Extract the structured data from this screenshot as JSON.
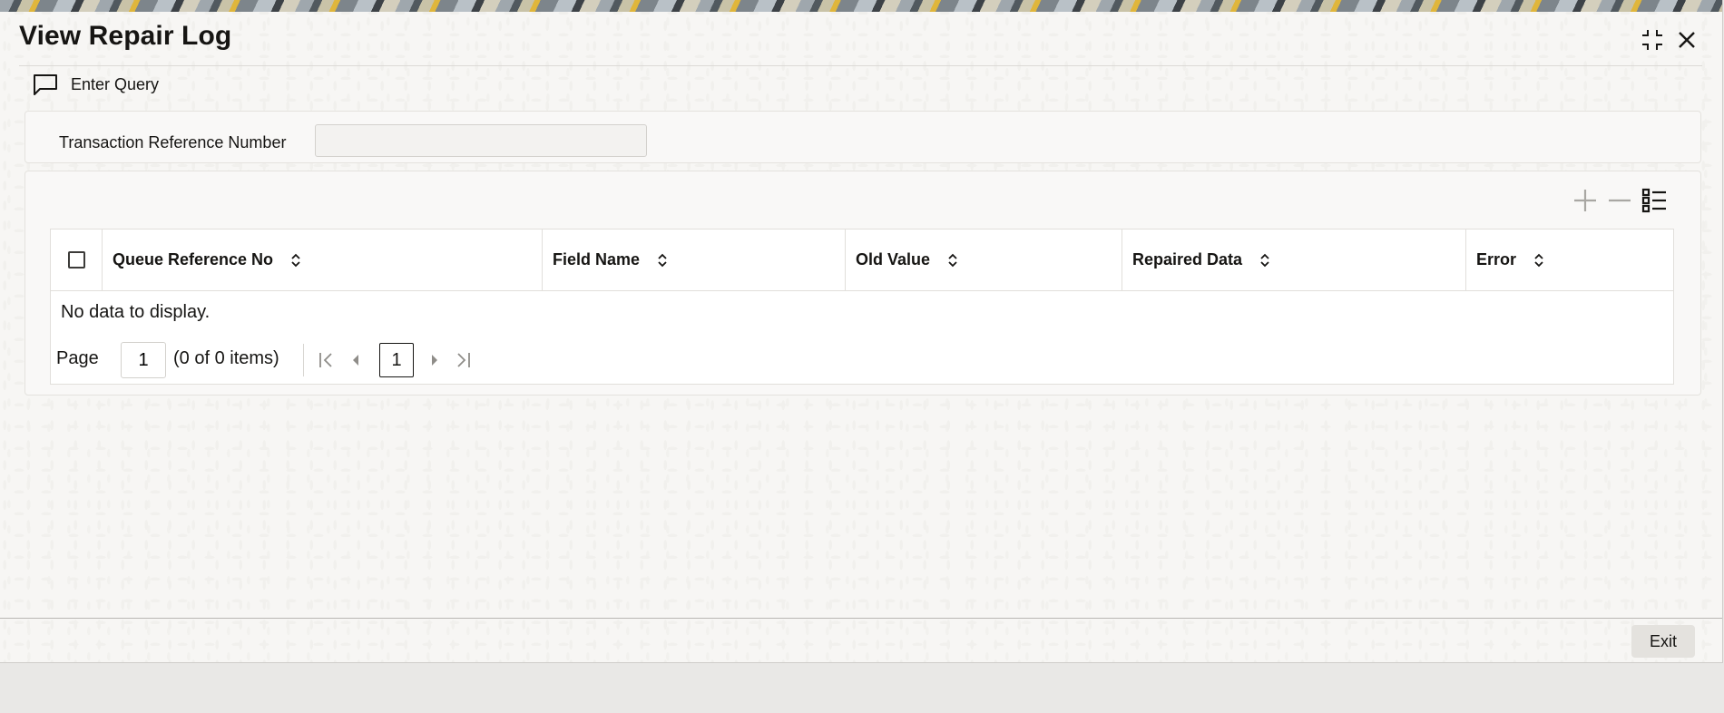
{
  "window": {
    "title": "View Repair Log",
    "controls": {
      "restore_icon": "collapse-arrows-icon",
      "close_icon": "close-icon"
    }
  },
  "toolbar": {
    "enter_query_label": "Enter Query",
    "enter_query_icon": "speech-bubble-icon"
  },
  "query_form": {
    "transaction_ref_label": "Transaction Reference Number",
    "transaction_ref_value": ""
  },
  "grid": {
    "tools": [
      "add-row-icon",
      "delete-row-icon",
      "column-list-icon"
    ],
    "columns": [
      {
        "label": "Queue Reference No"
      },
      {
        "label": "Field Name"
      },
      {
        "label": "Old Value"
      },
      {
        "label": "Repaired Data"
      },
      {
        "label": "Error"
      }
    ],
    "empty_message": "No data to display.",
    "pager": {
      "page_label": "Page",
      "page_input_value": "1",
      "item_count": "(0 of 0 items)",
      "current_page": "1"
    }
  },
  "footer": {
    "exit_label": "Exit"
  },
  "colors": {
    "accent": "#161513",
    "panel": "#f9f8f7",
    "background": "#f7f6f4"
  }
}
